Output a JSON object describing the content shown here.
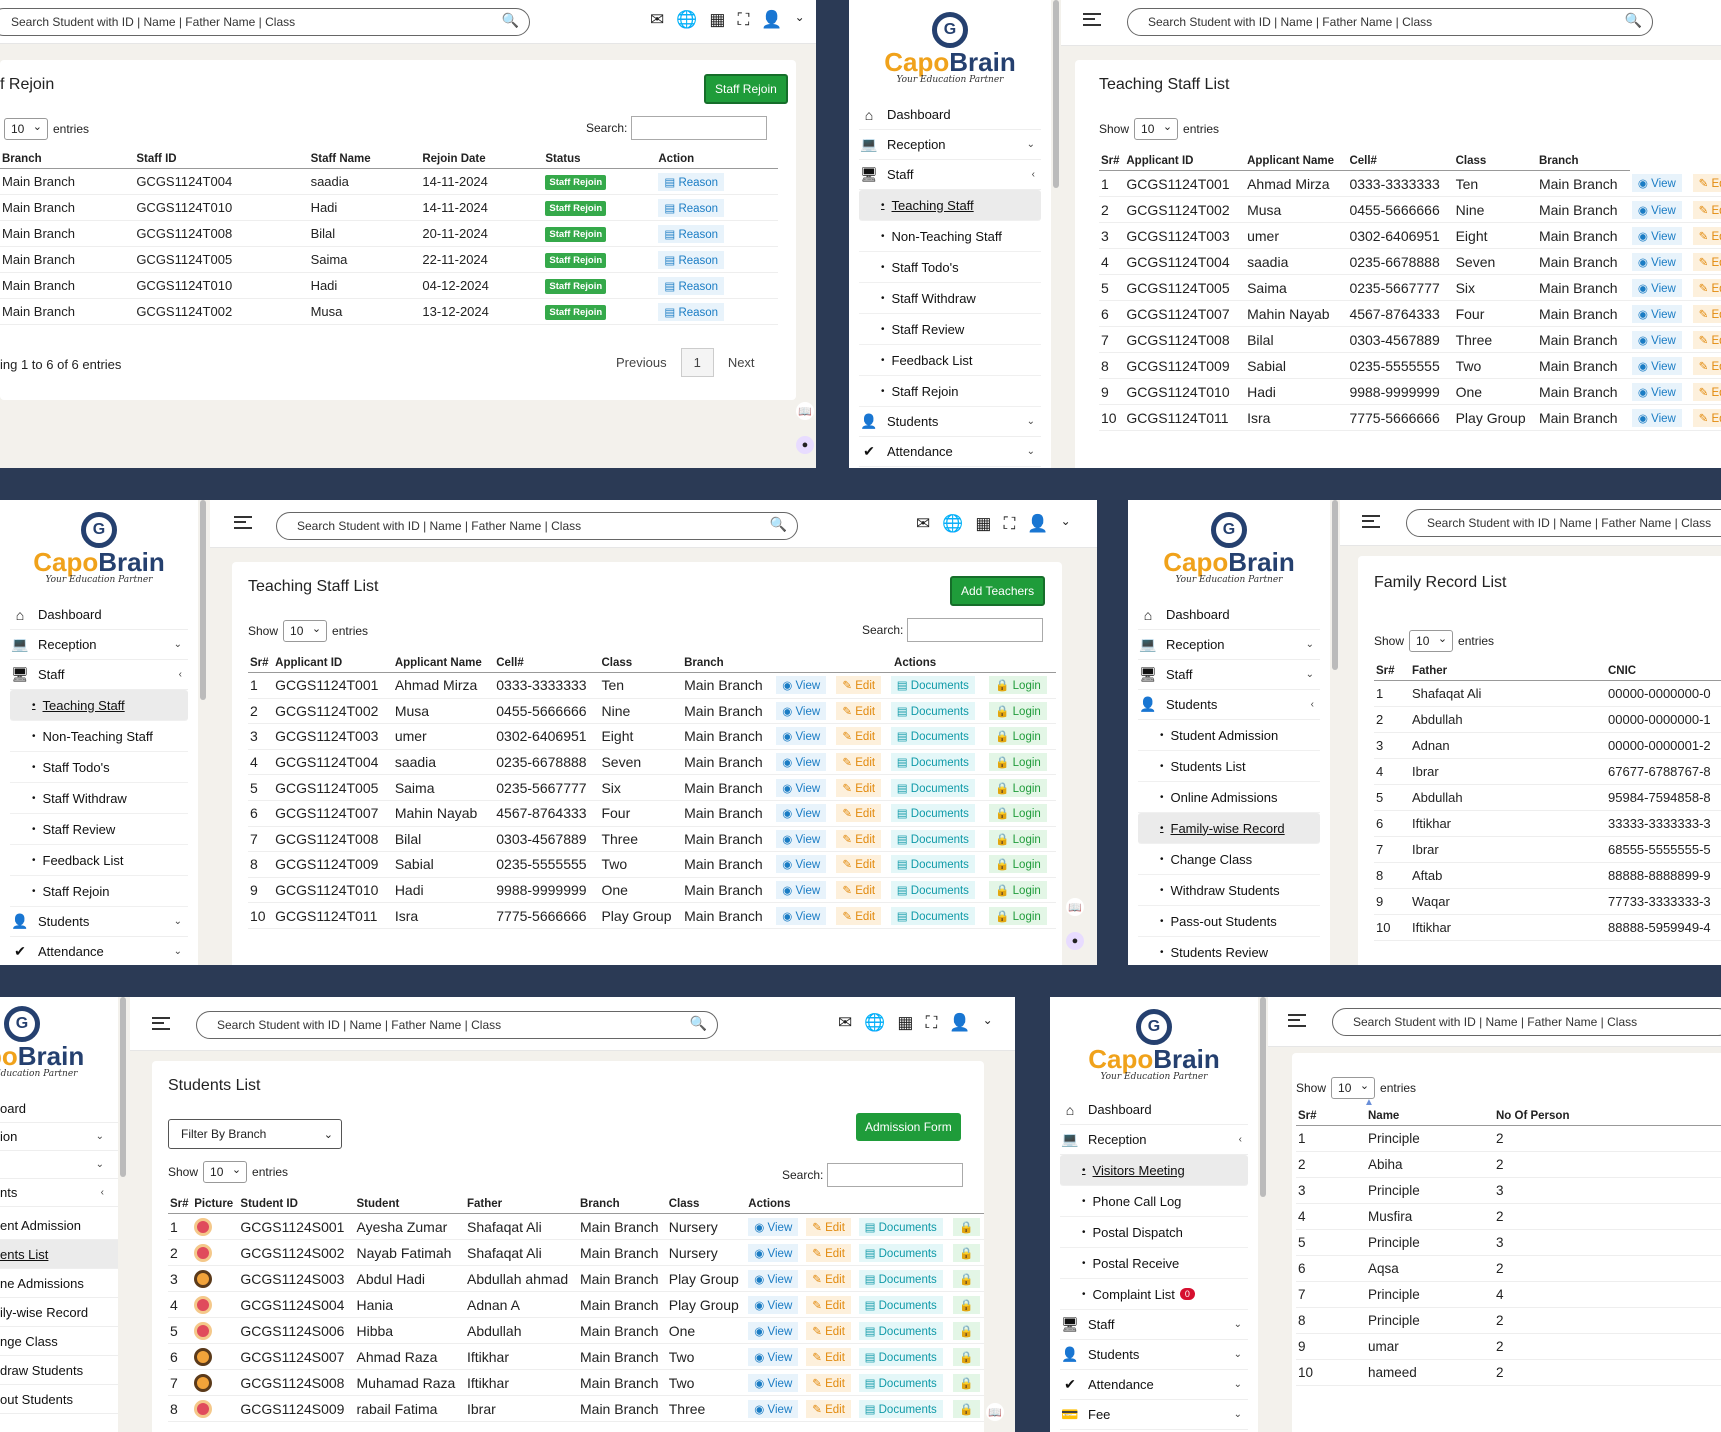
{
  "common": {
    "search_placeholder": "Search Student with ID | Name | Father Name | Class",
    "brand_c1": "Capo",
    "brand_c2": "Brain",
    "brand_tag": "Your Education Partner",
    "show": "Show",
    "entries": "entries",
    "search_label": "Search:",
    "page_size": "10"
  },
  "p1": {
    "title": "f Rejoin",
    "button": "Staff Rejoin",
    "columns": [
      "Branch",
      "Staff ID",
      "Staff Name",
      "Rejoin Date",
      "Status",
      "Action"
    ],
    "status_label": "Staff Rejoin",
    "action_label": "Reason",
    "rows": [
      [
        "Main Branch",
        "GCGS1124T004",
        "saadia",
        "14-11-2024"
      ],
      [
        "Main Branch",
        "GCGS1124T010",
        "Hadi",
        "14-11-2024"
      ],
      [
        "Main Branch",
        "GCGS1124T008",
        "Bilal",
        "20-11-2024"
      ],
      [
        "Main Branch",
        "GCGS1124T005",
        "Saima",
        "22-11-2024"
      ],
      [
        "Main Branch",
        "GCGS1124T010",
        "Hadi",
        "04-12-2024"
      ],
      [
        "Main Branch",
        "GCGS1124T002",
        "Musa",
        "13-12-2024"
      ]
    ],
    "footer": "ing 1 to 6 of 6 entries",
    "prev": "Previous",
    "page": "1",
    "next": "Next"
  },
  "staff_menu": {
    "dashboard": "Dashboard",
    "reception": "Reception",
    "staff": "Staff",
    "students": "Students",
    "attendance": "Attendance",
    "subs": [
      "Teaching Staff",
      "Non-Teaching Staff",
      "Staff Todo's",
      "Staff Withdraw",
      "Staff Review",
      "Feedback List",
      "Staff Rejoin"
    ]
  },
  "teaching": {
    "title": "Teaching Staff List",
    "button": "Add Teachers",
    "columns": [
      "Sr#",
      "Applicant ID",
      "Applicant Name",
      "Cell#",
      "Class",
      "Branch",
      "Actions"
    ],
    "actions": {
      "view": "View",
      "edit": "Edit",
      "docs": "Documents",
      "login": "Login",
      "ed_short": "Ed"
    },
    "rows": [
      [
        "1",
        "GCGS1124T001",
        "Ahmad Mirza",
        "0333-3333333",
        "Ten",
        "Main Branch"
      ],
      [
        "2",
        "GCGS1124T002",
        "Musa",
        "0455-5666666",
        "Nine",
        "Main Branch"
      ],
      [
        "3",
        "GCGS1124T003",
        "umer",
        "0302-6406951",
        "Eight",
        "Main Branch"
      ],
      [
        "4",
        "GCGS1124T004",
        "saadia",
        "0235-6678888",
        "Seven",
        "Main Branch"
      ],
      [
        "5",
        "GCGS1124T005",
        "Saima",
        "0235-5667777",
        "Six",
        "Main Branch"
      ],
      [
        "6",
        "GCGS1124T007",
        "Mahin Nayab",
        "4567-8764333",
        "Four",
        "Main Branch"
      ],
      [
        "7",
        "GCGS1124T008",
        "Bilal",
        "0303-4567889",
        "Three",
        "Main Branch"
      ],
      [
        "8",
        "GCGS1124T009",
        "Sabial",
        "0235-5555555",
        "Two",
        "Main Branch"
      ],
      [
        "9",
        "GCGS1124T010",
        "Hadi",
        "9988-9999999",
        "One",
        "Main Branch"
      ],
      [
        "10",
        "GCGS1124T011",
        "Isra",
        "7775-5666666",
        "Play Group",
        "Main Branch"
      ]
    ]
  },
  "family": {
    "title": "Family Record List",
    "menu_subs": [
      "Student Admission",
      "Students List",
      "Online Admissions",
      "Family-wise Record",
      "Change Class",
      "Withdraw Students",
      "Pass-out Students",
      "Students Review"
    ],
    "columns": [
      "Sr#",
      "Father",
      "CNIC"
    ],
    "rows": [
      [
        "1",
        "Shafaqat Ali",
        "00000-0000000-0"
      ],
      [
        "2",
        "Abdullah",
        "00000-0000000-1"
      ],
      [
        "3",
        "Adnan",
        "00000-0000001-2"
      ],
      [
        "4",
        "Ibrar",
        "67677-6788767-8"
      ],
      [
        "5",
        "Abdullah",
        "95984-7594858-8"
      ],
      [
        "6",
        "Iftikhar",
        "33333-3333333-3"
      ],
      [
        "7",
        "Ibrar",
        "68555-5555555-5"
      ],
      [
        "8",
        "Aftab",
        "88888-8888899-9"
      ],
      [
        "9",
        "Waqar",
        "77733-3333333-3"
      ],
      [
        "10",
        "Iftikhar",
        "88888-5959949-4"
      ]
    ]
  },
  "students": {
    "title": "Students List",
    "filter": "Filter By Branch",
    "button": "Admission Form",
    "menu_frag": [
      "oard",
      "ion",
      "",
      "nts",
      "ent Admission",
      "ents List",
      "ne Admissions",
      "ily-wise Record",
      "nge Class",
      "draw Students",
      "out Students"
    ],
    "columns": [
      "Sr#",
      "Picture",
      "Student ID",
      "Student",
      "Father",
      "Branch",
      "Class",
      "Actions"
    ],
    "rows": [
      [
        "1",
        "GCGS1124S001",
        "Ayesha Zumar",
        "Shafaqat Ali",
        "Main Branch",
        "Nursery"
      ],
      [
        "2",
        "GCGS1124S002",
        "Nayab Fatimah",
        "Shafaqat Ali",
        "Main Branch",
        "Nursery"
      ],
      [
        "3",
        "GCGS1124S003",
        "Abdul Hadi",
        "Abdullah ahmad",
        "Main Branch",
        "Play Group"
      ],
      [
        "4",
        "GCGS1124S004",
        "Hania",
        "Adnan A",
        "Main Branch",
        "Play Group"
      ],
      [
        "5",
        "GCGS1124S006",
        "Hibba",
        "Abdullah",
        "Main Branch",
        "One"
      ],
      [
        "6",
        "GCGS1124S007",
        "Ahmad Raza",
        "Iftikhar",
        "Main Branch",
        "Two"
      ],
      [
        "7",
        "GCGS1124S008",
        "Muhamad Raza",
        "Iftikhar",
        "Main Branch",
        "Two"
      ],
      [
        "8",
        "GCGS1124S009",
        "rabail Fatima",
        "Ibrar",
        "Main Branch",
        "Three"
      ]
    ]
  },
  "visitors": {
    "menu_subs": [
      "Visitors Meeting",
      "Phone Call Log",
      "Postal Dispatch",
      "Postal Receive",
      "Complaint List"
    ],
    "complaint_count": "0",
    "fee": "Fee",
    "columns": [
      "Sr#",
      "Name",
      "No Of Person"
    ],
    "rows": [
      [
        "1",
        "Principle",
        "2"
      ],
      [
        "2",
        "Abiha",
        "2"
      ],
      [
        "3",
        "Principle",
        "3"
      ],
      [
        "4",
        "Musfira",
        "2"
      ],
      [
        "5",
        "Principle",
        "3"
      ],
      [
        "6",
        "Aqsa",
        "2"
      ],
      [
        "7",
        "Principle",
        "4"
      ],
      [
        "8",
        "Principle",
        "2"
      ],
      [
        "9",
        "umar",
        "2"
      ],
      [
        "10",
        "hameed",
        "2"
      ]
    ]
  }
}
